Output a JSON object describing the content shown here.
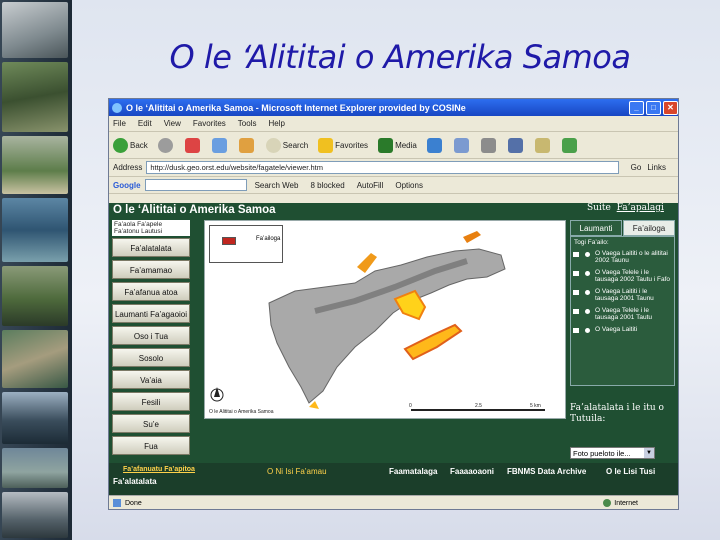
{
  "slide": {
    "title": "O le ‘Alititai o Amerika Samoa"
  },
  "browser": {
    "window_title": "O le ‘Alititai o Amerika Samoa - Microsoft Internet Explorer provided by COSINe",
    "menu": [
      "File",
      "Edit",
      "View",
      "Favorites",
      "Tools",
      "Help"
    ],
    "toolbar": {
      "back": "Back",
      "search": "Search",
      "favorites": "Favorites",
      "media": "Media"
    },
    "address_label": "Address",
    "address_value": "http://dusk.geo.orst.edu/website/fagatele/viewer.htm",
    "go_label": "Go",
    "links_label": "Links",
    "google_bar": {
      "brand": "Google",
      "search_web": "Search Web",
      "blocked": "8 blocked",
      "autofill": "AutoFill",
      "options": "Options"
    },
    "status": {
      "left": "Done",
      "right": "Internet"
    }
  },
  "page": {
    "title": "O le ‘Alititai o Amerika Samoa",
    "suite": {
      "prefix": "Suite",
      "link": "Fa’apalagi"
    },
    "nav_header": "Fa’aola Fa’apele Fa’atonu Lautusi",
    "nav_items": [
      "Fa’alatalata",
      "Fa’amamao",
      "Fa’afanua atoa",
      "Laumanti Fa’agaoioi",
      "Oso i Tua",
      "Sosolo",
      "Va’aia",
      "Fesili",
      "Su’e",
      "Fua"
    ],
    "tabs": [
      "Laumanti",
      "Fa’ailoga"
    ],
    "tab_list_header": "Togi Fa’ailo:",
    "layers": [
      {
        "label": "O Vaega Laititi o le alititai 2002 Taunu",
        "checked": true
      },
      {
        "label": "O Vaega Telele i le tausaga 2002 Tautu i Fafo",
        "checked": true
      },
      {
        "label": "O Vaega Laititi i le tausaga 2001 Taunu",
        "checked": true
      },
      {
        "label": "O Vaega Telele i le tausaga 2001 Tautu",
        "checked": true
      },
      {
        "label": "O Vaega Laititi",
        "checked": true
      }
    ],
    "info_text": "Fa’alatalata i le itu o Tutuila:",
    "photo_select": "Foto pueloto ile...",
    "map": {
      "legend_title": "Fa’ailoga",
      "scale_labels": [
        "0",
        "2.5",
        "5 km"
      ],
      "footer_note": "O le Alititai o Amerika Samoa"
    },
    "bottom": {
      "left_link": "Fa’afanuatu Fa’apitoa",
      "left_sub": "Fa’alatalata",
      "middle_prefix": "O Ni Isi Fa’amau",
      "links": [
        "Faamatalaga",
        "Faaaaoaoni",
        "FBNMS Data Archive",
        "O le Lisi Tusi"
      ]
    }
  }
}
